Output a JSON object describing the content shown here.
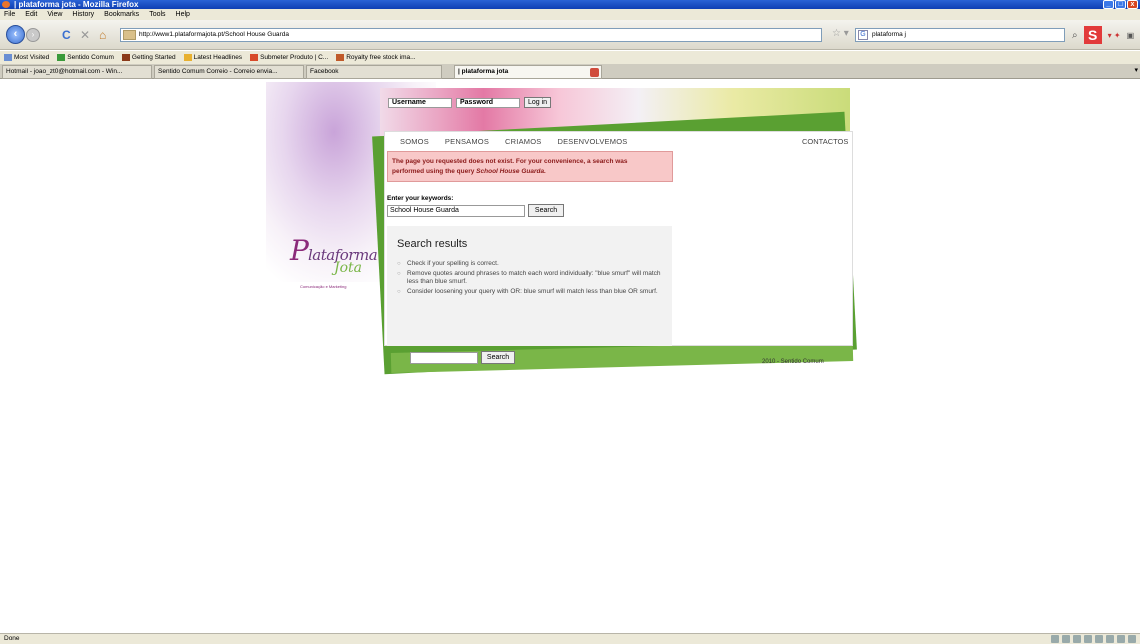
{
  "window": {
    "title": "| plataforma jota - Mozilla Firefox"
  },
  "menu": [
    "File",
    "Edit",
    "View",
    "History",
    "Bookmarks",
    "Tools",
    "Help"
  ],
  "toolbar": {
    "url": "http://www1.plataformajota.pt/School House Guarda",
    "search_value": "plataforma j"
  },
  "bookmarks": [
    "Most Visited",
    "Sentido Comum",
    "Getting Started",
    "Latest Headlines",
    "Submeter Produto | C...",
    "Royalty free stock ima..."
  ],
  "tabs": [
    {
      "label": "Hotmail - joao_zt0@hotmail.com - Win..."
    },
    {
      "label": "Sentido Comum Correio - Correio envia..."
    },
    {
      "label": "Facebook"
    },
    {
      "label": "| plataforma jota"
    }
  ],
  "login": {
    "username_label": "Username",
    "password_label": "Password",
    "button": "Log in"
  },
  "nav": {
    "items": [
      "SOMOS",
      "PENSAMOS",
      "CRIAMOS",
      "DESENVOLVEMOS"
    ],
    "contact": "CONTACTOS"
  },
  "notice": {
    "text_1": "The page you requested does not exist. For your convenience, a search was",
    "text_2": "performed using the query",
    "query": "School House Guarda."
  },
  "search_form": {
    "label": "Enter your keywords:",
    "value": "School House Guarda",
    "button": "Search"
  },
  "results": {
    "title": "Search results",
    "tips": [
      "Check if your spelling is correct.",
      "Remove quotes around phrases to match each word individually: \"blue smurf\" will match less than blue smurf.",
      "Consider loosening your query with OR: blue smurf will match less than blue OR smurf."
    ]
  },
  "footer": {
    "search_button": "Search",
    "copyright": "2010 - Sentido Comum"
  },
  "logo": {
    "initial": "P",
    "word": "lataforma",
    "word2": "Jota",
    "tagline": "Comunicação e Marketing"
  },
  "status": {
    "text": "Done"
  }
}
